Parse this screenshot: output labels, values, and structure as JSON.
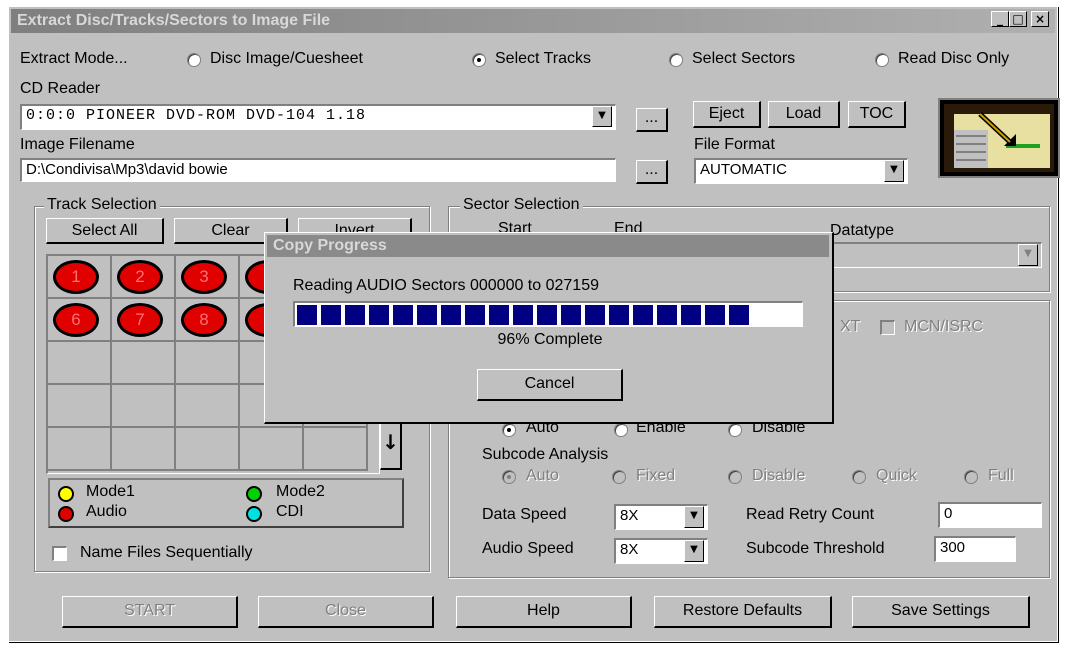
{
  "window": {
    "title": "Extract Disc/Tracks/Sectors to Image File",
    "buttons": {
      "minimize": "_",
      "maximize": "□",
      "close": "×"
    }
  },
  "extract_mode": {
    "label": "Extract Mode...",
    "options": [
      "Disc Image/Cuesheet",
      "Select Tracks",
      "Select Sectors",
      "Read Disc Only"
    ],
    "selected": "Select Tracks"
  },
  "cd_reader": {
    "label": "CD Reader",
    "value": "0:0:0 PIONEER  DVD-ROM DVD-104  1.18",
    "browse": "..."
  },
  "drive_buttons": {
    "eject": "Eject",
    "load": "Load",
    "toc": "TOC"
  },
  "image_filename": {
    "label": "Image Filename",
    "value": "D:\\Condivisa\\Mp3\\david bowie",
    "browse": "..."
  },
  "file_format": {
    "label": "File Format",
    "value": "AUTOMATIC"
  },
  "track_selection": {
    "title": "Track Selection",
    "select_all": "Select All",
    "clear": "Clear",
    "invert": "Invert",
    "tracks_row1": [
      "1",
      "2",
      "3"
    ],
    "tracks_row2": [
      "6",
      "7",
      "8"
    ],
    "legend": [
      {
        "label": "Mode1",
        "color": "#ffff00"
      },
      {
        "label": "Mode2",
        "color": "#00d000"
      },
      {
        "label": "Audio",
        "color": "#e00000"
      },
      {
        "label": "CDI",
        "color": "#00e0e0"
      }
    ],
    "name_sequential": "Name Files Sequentially"
  },
  "sector_selection": {
    "title": "Sector Selection",
    "start_label": "Start",
    "end_label": "End",
    "datatype_label": "Datatype"
  },
  "options": {
    "cd_text_partial": "XT",
    "mcn_isrc": "MCN/ISRC",
    "mode_options": [
      "Auto",
      "Enable",
      "Disable"
    ],
    "mode_selected": "Auto",
    "subcode_label": "Subcode Analysis",
    "subcode_options": [
      "Auto",
      "Fixed",
      "Disable",
      "Quick",
      "Full"
    ],
    "subcode_selected": "Auto",
    "data_speed_label": "Data Speed",
    "data_speed": "8X",
    "audio_speed_label": "Audio Speed",
    "audio_speed": "8X",
    "read_retry_label": "Read Retry Count",
    "read_retry": "0",
    "subcode_threshold_label": "Subcode Threshold",
    "subcode_threshold": "300"
  },
  "bottom_buttons": {
    "start": "START",
    "close": "Close",
    "help": "Help",
    "restore": "Restore Defaults",
    "save": "Save Settings"
  },
  "progress_dialog": {
    "title": "Copy Progress",
    "status": "Reading AUDIO Sectors 000000 to 027159",
    "percent_text": "96% Complete",
    "progress": 0.96,
    "cancel": "Cancel"
  }
}
